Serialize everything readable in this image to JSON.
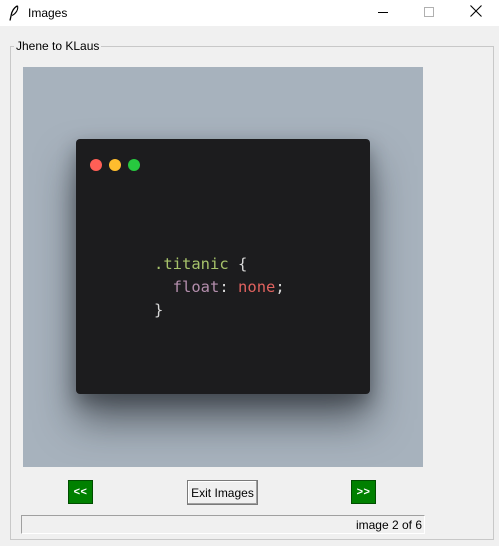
{
  "window": {
    "title": "Images",
    "icons": {
      "app": "feather-icon",
      "minimize": "minimize-icon",
      "maximize": "maximize-icon",
      "close": "close-icon"
    }
  },
  "frame": {
    "title": "Jhene to KLaus"
  },
  "image": {
    "code": {
      "selector": ".titanic",
      "open_brace": "{",
      "property": "float",
      "colon": ":",
      "value": "none",
      "semicolon": ";",
      "close_brace": "}"
    },
    "colors": {
      "background": "#a7b2bd",
      "editor": "#1c1c1e",
      "dot_red": "#ff5f56",
      "dot_yellow": "#ffbd2e",
      "dot_green": "#27c93f"
    }
  },
  "controls": {
    "prev_label": "<<",
    "exit_label": "Exit Images",
    "next_label": ">>",
    "nav_color": "#008000"
  },
  "status": {
    "text": "image 2 of 6"
  }
}
